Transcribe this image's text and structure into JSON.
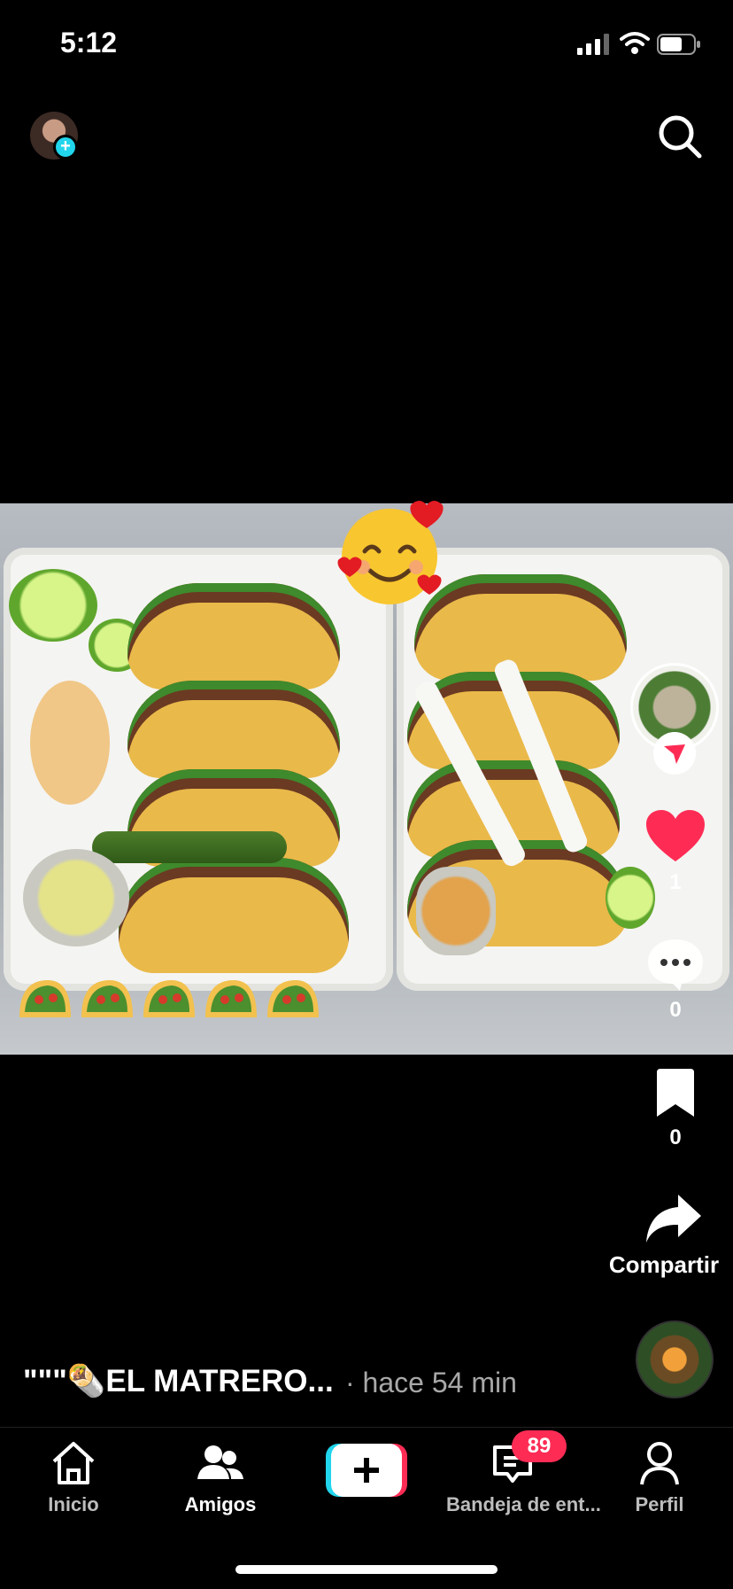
{
  "status": {
    "time": "5:12"
  },
  "post": {
    "caption": "\"\"\"🌯EL MATRERO...",
    "time_ago": "· hace 54 min",
    "likes": "1",
    "comments": "0",
    "saves": "0",
    "share_label": "Compartir"
  },
  "nav": {
    "home_label": "Inicio",
    "friends_label": "Amigos",
    "inbox_label": "Bandeja de ent...",
    "profile_label": "Perfil",
    "inbox_badge": "89"
  },
  "icons": {
    "search": "search-icon",
    "like": "heart-icon",
    "comment": "comment-icon",
    "bookmark": "bookmark-icon",
    "share": "share-arrow-icon",
    "home": "home-icon",
    "friends": "friends-icon",
    "create": "plus-icon",
    "inbox": "inbox-icon",
    "profile": "person-icon"
  },
  "colors": {
    "accent_red": "#fe2c55",
    "accent_cyan": "#20d5ec",
    "background": "#000000"
  }
}
